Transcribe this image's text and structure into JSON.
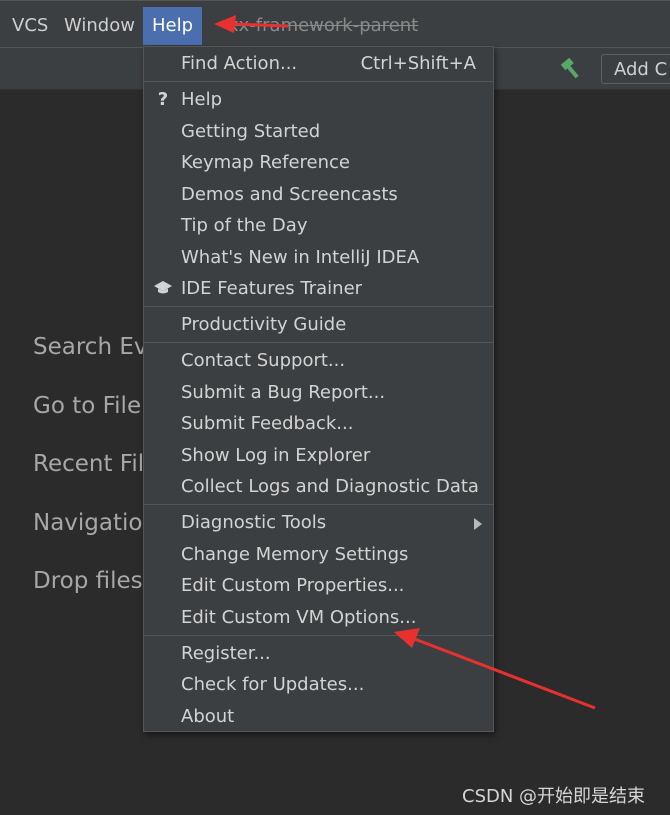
{
  "menubar": {
    "items": [
      {
        "label": "VCS"
      },
      {
        "label": "Window"
      },
      {
        "label": "Help"
      }
    ],
    "project_title": "xx-framework-parent"
  },
  "toolbar": {
    "add_config_label": "Add C"
  },
  "welcome": {
    "lines": [
      "Search Ev",
      "Go to File",
      "Recent Fil",
      "Navigatio",
      "Drop files"
    ]
  },
  "help_menu": {
    "find_action": {
      "label": "Find Action...",
      "shortcut": "Ctrl+Shift+A"
    },
    "group1": [
      {
        "label": "Help",
        "icon": "question-icon"
      },
      {
        "label": "Getting Started"
      },
      {
        "label": "Keymap Reference"
      },
      {
        "label": "Demos and Screencasts"
      },
      {
        "label": "Tip of the Day"
      },
      {
        "label": "What's New in IntelliJ IDEA"
      },
      {
        "label": "IDE Features Trainer",
        "icon": "graduation-cap-icon"
      }
    ],
    "group2": [
      {
        "label": "Productivity Guide"
      }
    ],
    "group3": [
      {
        "label": "Contact Support..."
      },
      {
        "label": "Submit a Bug Report..."
      },
      {
        "label": "Submit Feedback..."
      },
      {
        "label": "Show Log in Explorer"
      },
      {
        "label": "Collect Logs and Diagnostic Data"
      }
    ],
    "group4": [
      {
        "label": "Diagnostic Tools"
      },
      {
        "label": "Change Memory Settings"
      },
      {
        "label": "Edit Custom Properties..."
      },
      {
        "label": "Edit Custom VM Options..."
      }
    ],
    "group5": [
      {
        "label": "Register..."
      },
      {
        "label": "Check for Updates..."
      },
      {
        "label": "About"
      }
    ]
  },
  "watermark": "CSDN @开始即是结束",
  "colors": {
    "accent": "#4b6eaf",
    "background": "#2b2b2b",
    "menu": "#3c3f41",
    "annotation_arrow": "#e8312f"
  }
}
